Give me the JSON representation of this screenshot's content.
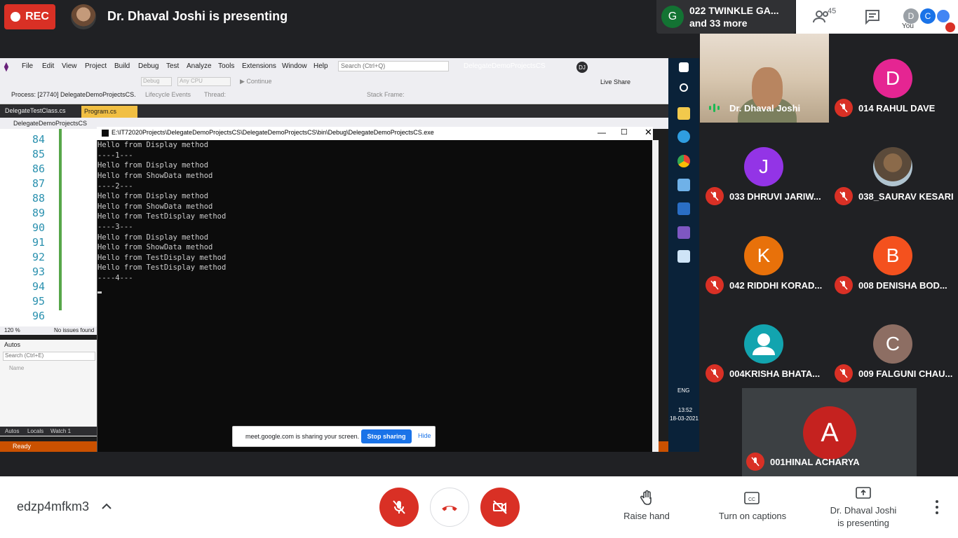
{
  "top": {
    "rec_label": "REC",
    "presenting_title": "Dr. Dhaval Joshi is presenting",
    "pinned_initial": "G",
    "pinned_name": "022 TWINKLE GA...",
    "pinned_more": "and 33 more",
    "people_count": "45",
    "you_d": "D",
    "you_c": "C",
    "you_label": "You"
  },
  "vs": {
    "menu": [
      "File",
      "Edit",
      "View",
      "Project",
      "Build",
      "Debug",
      "Test",
      "Analyze",
      "Tools",
      "Extensions",
      "Window",
      "Help"
    ],
    "search_placeholder": "Search (Ctrl+Q)",
    "project_name": "DelegateDemoProjectsCS",
    "user_initials": "DJ",
    "debug_config": "Debug",
    "platform": "Any CPU",
    "continue_label": "Continue",
    "live_share": "Live Share",
    "process": "Process: [27740] DelegateDemoProjectsCS.",
    "lifecycle": "Lifecycle Events",
    "thread": "Thread:",
    "stack_frame": "Stack Frame:",
    "tab1": "DelegateTestClass.cs",
    "tab2": "Program.cs",
    "nav_project": "DelegateDemoProjectsCS",
    "line_numbers": [
      "84",
      "85",
      "86",
      "87",
      "88",
      "89",
      "90",
      "91",
      "92",
      "93",
      "94",
      "95",
      "96"
    ],
    "zoom": "120 %",
    "no_issues": "No issues found",
    "autos_title": "Autos",
    "autos_search": "Search (Ctrl+E)",
    "autos_name_col": "Name",
    "bottom_tabs": [
      "Autos",
      "Locals",
      "Watch 1"
    ],
    "status": "Ready"
  },
  "taskbar": {
    "lang": "ENG",
    "time": "13:52",
    "date": "18-03-2021"
  },
  "console": {
    "path": "E:\\IT72020Projects\\DelegateDemoProjectsCS\\DelegateDemoProjectsCS\\bin\\Debug\\DelegateDemoProjectsCS.exe",
    "lines": [
      "Hello from Display method",
      "----1---",
      "Hello from Display method",
      "Hello from ShowData method",
      "----2---",
      "Hello from Display method",
      "Hello from ShowData method",
      "Hello from TestDisplay method",
      "----3---",
      "Hello from Display method",
      "Hello from ShowData method",
      "Hello from TestDisplay method",
      "Hello from TestDisplay method",
      "----4---"
    ]
  },
  "share_banner": {
    "text": "meet.google.com is sharing your screen.",
    "stop": "Stop sharing",
    "hide": "Hide"
  },
  "participants": {
    "presenter": "Dr. Dhaval Joshi",
    "tiles": [
      {
        "initial": "D",
        "name": "014 RAHUL DAVE",
        "color": "#e52592"
      },
      {
        "initial": "J",
        "name": "033 DHRUVI JARIW...",
        "color": "#9334e6"
      },
      {
        "initial": "",
        "name": "038_SAURAV KESARI",
        "color": "#5b4a3a"
      },
      {
        "initial": "K",
        "name": "042 RIDDHI KORAD...",
        "color": "#e8710a"
      },
      {
        "initial": "B",
        "name": "008 DENISHA BOD...",
        "color": "#f4511e"
      },
      {
        "initial": "",
        "name": "004KRISHA BHATA...",
        "color": "#12a4af"
      },
      {
        "initial": "C",
        "name": "009 FALGUNI CHAU...",
        "color": "#8d6e63"
      },
      {
        "initial": "A",
        "name": "001HINAL ACHARYA",
        "color": "#c5221f"
      }
    ]
  },
  "bottom": {
    "meeting_code": "edzp4mfkm3",
    "raise_hand": "Raise hand",
    "captions": "Turn on captions",
    "presenting_line1": "Dr. Dhaval Joshi",
    "presenting_line2": "is presenting"
  },
  "colors": {
    "meet_red": "#d93025",
    "meet_blue": "#1a73e8",
    "vs_status_orange": "#ca5100"
  }
}
